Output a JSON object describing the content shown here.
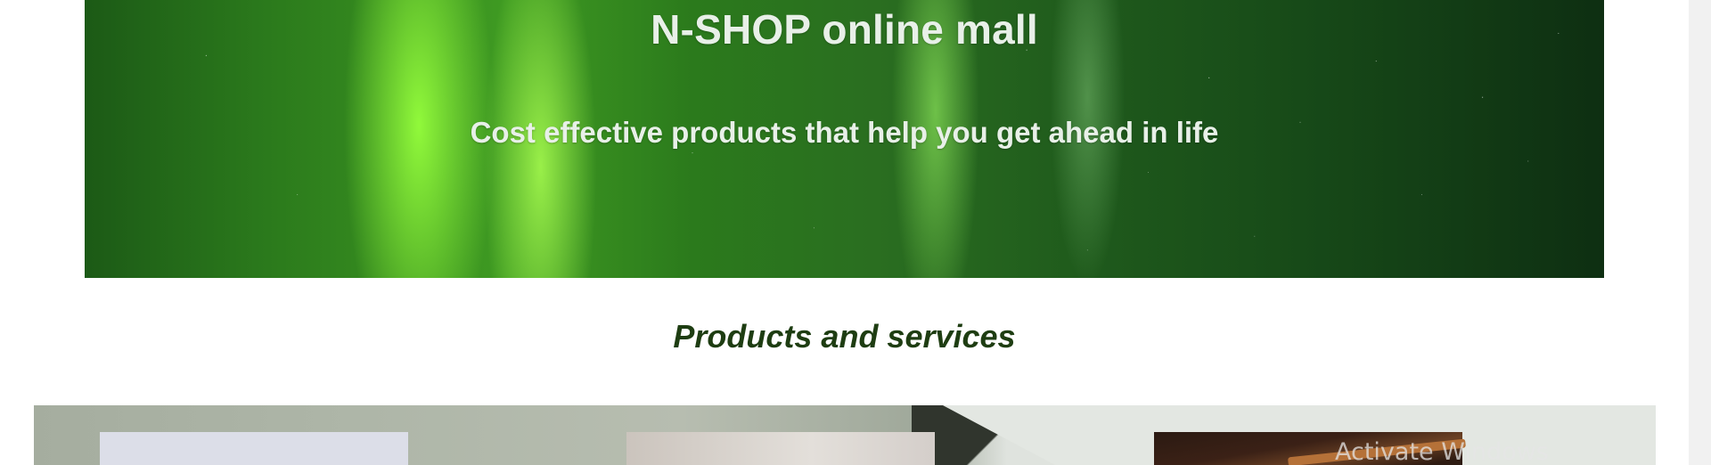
{
  "hero": {
    "title": "N-SHOP online mall",
    "subtitle": "Cost effective products that help you get ahead in life"
  },
  "products": {
    "heading": "Products and services"
  },
  "watermark": {
    "text": "Activate Windows"
  },
  "colors": {
    "heading": "#1e3d12",
    "hero_text": "#e8f0e8",
    "hero_green": "#3f9b22"
  }
}
